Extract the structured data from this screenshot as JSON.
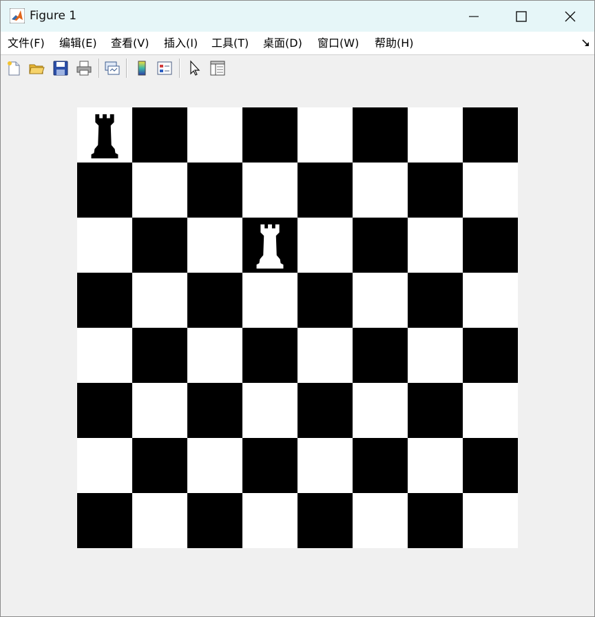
{
  "window": {
    "title": "Figure 1",
    "title_bar_color": "#e6f6f8"
  },
  "menu": {
    "items": [
      {
        "label": "文件(F)"
      },
      {
        "label": "编辑(E)"
      },
      {
        "label": "查看(V)"
      },
      {
        "label": "插入(I)"
      },
      {
        "label": "工具(T)"
      },
      {
        "label": "桌面(D)"
      },
      {
        "label": "窗口(W)"
      },
      {
        "label": "帮助(H)"
      }
    ]
  },
  "toolbar": {
    "buttons": [
      {
        "icon": "new-figure-icon"
      },
      {
        "icon": "open-file-icon"
      },
      {
        "icon": "save-icon"
      },
      {
        "icon": "print-icon"
      },
      {
        "icon": "link-plot-icon"
      },
      {
        "icon": "colorbar-icon"
      },
      {
        "icon": "legend-icon"
      },
      {
        "icon": "edit-plot-pointer-icon"
      },
      {
        "icon": "property-inspector-icon"
      }
    ]
  },
  "board": {
    "size": 8,
    "top_left_square": "white",
    "light_color": "#ffffff",
    "dark_color": "#000000",
    "pieces": [
      {
        "type": "rook",
        "color": "black",
        "row": 1,
        "col": 1
      },
      {
        "type": "rook",
        "color": "white",
        "row": 3,
        "col": 4
      }
    ]
  }
}
